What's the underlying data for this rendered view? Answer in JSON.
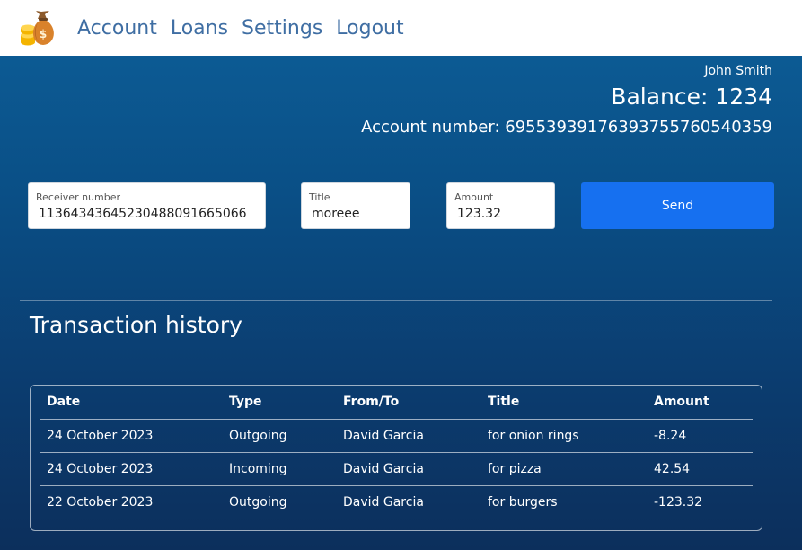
{
  "nav": {
    "logo_icon": "money-bag-coins-icon",
    "links": [
      "Account",
      "Loans",
      "Settings",
      "Logout"
    ]
  },
  "account": {
    "user_name": "John Smith",
    "balance": "Balance: 1234",
    "account_number": "Account number: 69553939176393755760540359"
  },
  "transfer_form": {
    "receiver_label": "Receiver number",
    "receiver_value": "11364343645230488091665066",
    "title_label": "Title",
    "title_value": "moreee",
    "amount_label": "Amount",
    "amount_value": "123.32",
    "send_label": "Send"
  },
  "history": {
    "title": "Transaction history",
    "columns": [
      "Date",
      "Type",
      "From/To",
      "Title",
      "Amount"
    ],
    "rows": [
      [
        "24 October 2023",
        "Outgoing",
        "David Garcia",
        "for onion rings",
        "-8.24"
      ],
      [
        "24 October 2023",
        "Incoming",
        "David Garcia",
        "for pizza",
        "42.54"
      ],
      [
        "22 October 2023",
        "Outgoing",
        "David Garcia",
        "for burgers",
        "-123.32"
      ]
    ]
  },
  "colors": {
    "accent": "#1670f0",
    "nav_link": "#3f6ea3",
    "background_top": "#0d5f99",
    "background_bottom": "#0c2f5c"
  }
}
